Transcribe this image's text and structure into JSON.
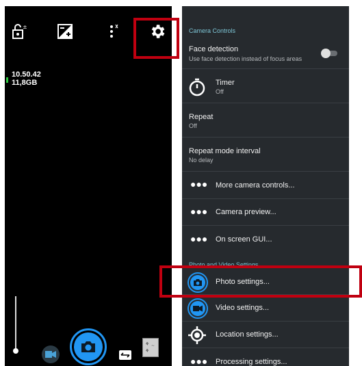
{
  "camera": {
    "time": "10.50.42",
    "storage": "11,8GB"
  },
  "settings": {
    "header_camera_controls": "Camera Controls",
    "face_detection": {
      "title": "Face detection",
      "subtitle": "Use face detection instead of focus areas",
      "enabled": false
    },
    "timer": {
      "title": "Timer",
      "value": "Off"
    },
    "repeat": {
      "title": "Repeat",
      "value": "Off"
    },
    "repeat_interval": {
      "title": "Repeat mode interval",
      "value": "No delay"
    },
    "more_camera_controls": "More camera controls...",
    "camera_preview": "Camera preview...",
    "on_screen_gui": "On screen GUI...",
    "header_photo_video": "Photo and Video Settings",
    "photo_settings": "Photo settings...",
    "video_settings": "Video settings...",
    "location_settings": "Location settings...",
    "processing_settings": "Processing settings..."
  },
  "colors": {
    "highlight": "#c00010",
    "accent_blue": "#2196f3",
    "header_teal": "#7ec6d6"
  }
}
